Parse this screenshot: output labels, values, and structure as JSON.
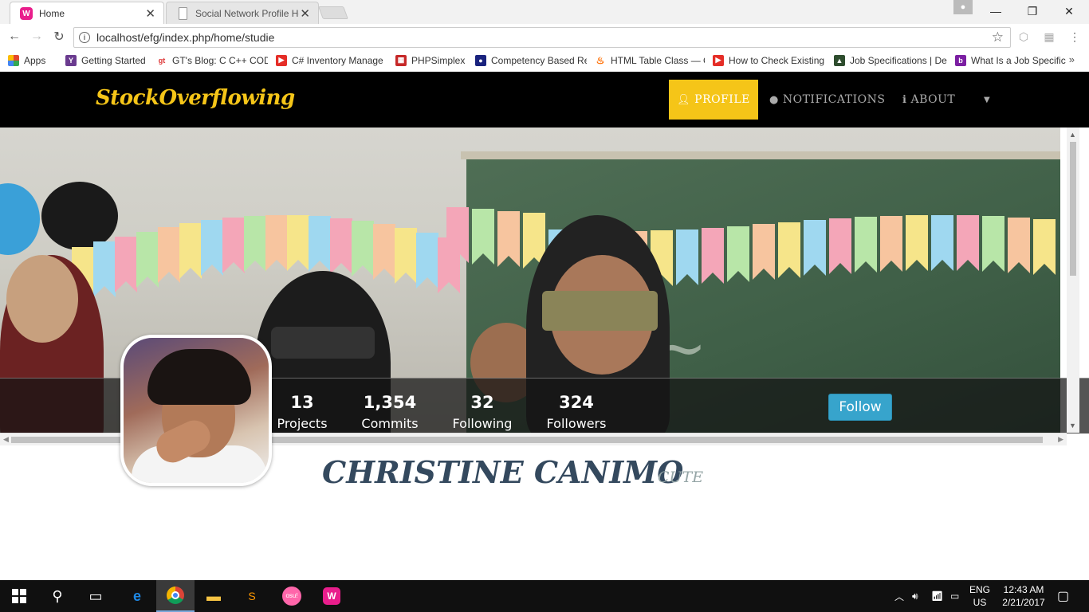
{
  "browser": {
    "tabs": [
      {
        "label": "Home",
        "favicon": "W"
      },
      {
        "label": "Social Network Profile He",
        "favicon": ""
      }
    ],
    "url": "localhost/efg/index.php/home/studie",
    "bookmarks": [
      {
        "label": "Apps",
        "icon": "apps-grid-icon",
        "color": "#e2462f"
      },
      {
        "label": "Getting Started",
        "icon": "bookmark-icon",
        "color": "#6a3b8f"
      },
      {
        "label": "GT's Blog: C C++ COD",
        "icon": "gt-icon",
        "color": "#d33"
      },
      {
        "label": "C# Inventory Manage",
        "icon": "youtube-icon",
        "color": "#e52d27"
      },
      {
        "label": "PHPSimplex",
        "icon": "calculator-icon",
        "color": "#c62828"
      },
      {
        "label": "Competency Based Re",
        "icon": "site-icon",
        "color": "#1a237e"
      },
      {
        "label": "HTML Table Class — C",
        "icon": "flame-icon",
        "color": "#ff6d00"
      },
      {
        "label": "How to Check Existing",
        "icon": "youtube-icon",
        "color": "#e52d27"
      },
      {
        "label": "Job Specifications | De",
        "icon": "site-icon",
        "color": "#2e4d2e"
      },
      {
        "label": "What Is a Job Specific",
        "icon": "site-icon",
        "color": "#7b1fa2"
      }
    ]
  },
  "site": {
    "brand": "StockOverflowing",
    "nav": [
      {
        "label": "PROFILE",
        "icon": "user-icon"
      },
      {
        "label": "NOTIFICATIONS",
        "icon": "globe-icon"
      },
      {
        "label": "ABOUT",
        "icon": "info-icon"
      }
    ]
  },
  "profile": {
    "name": "CHRISTINE CANIMO",
    "nickname": "CUTE",
    "stats": [
      {
        "value": "13",
        "label": "Projects"
      },
      {
        "value": "1,354",
        "label": "Commits"
      },
      {
        "value": "32",
        "label": "Following"
      },
      {
        "value": "324",
        "label": "Followers"
      }
    ],
    "follow_label": "Follow"
  },
  "taskbar": {
    "lang_top": "ENG",
    "lang_bottom": "US",
    "time": "12:43 AM",
    "date": "2/21/2017"
  },
  "colors": {
    "accent": "#f5c518",
    "follow": "#37a4cc",
    "name": "#34495e"
  }
}
